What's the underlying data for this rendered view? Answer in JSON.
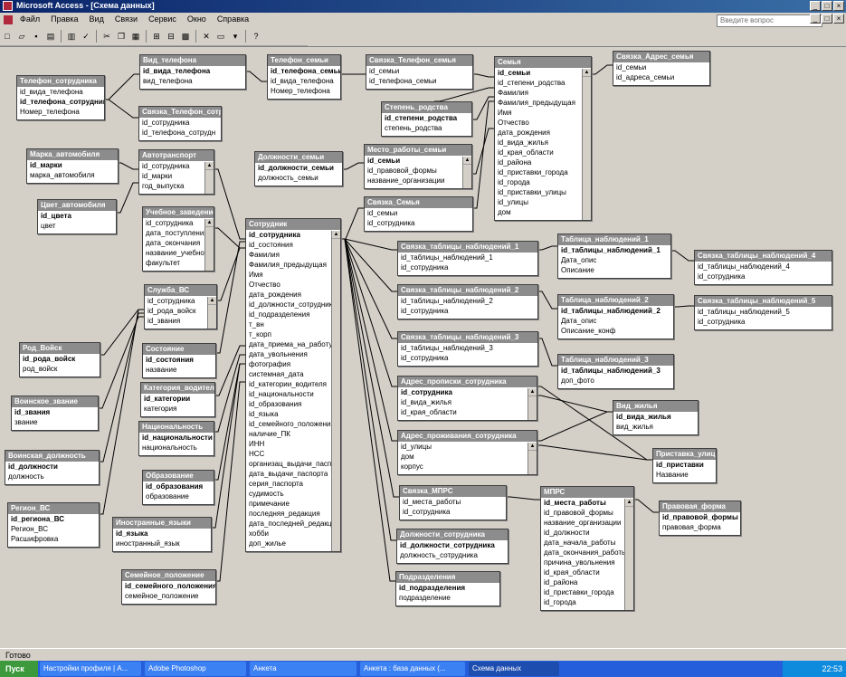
{
  "window": {
    "app_title": "Microsoft Access - [Схема данных]",
    "minimize": "_",
    "maximize": "□",
    "close": "×"
  },
  "menu": {
    "items": [
      "Файл",
      "Правка",
      "Вид",
      "Связи",
      "Сервис",
      "Окно",
      "Справка"
    ],
    "ask_placeholder": "Введите вопрос"
  },
  "toolbar": {
    "icons": [
      "new-icon",
      "open-icon",
      "save-icon",
      "print-preview-icon",
      "print-icon",
      "spell-icon",
      "cut-icon",
      "copy-icon",
      "paste-icon",
      "show-table-icon",
      "show-direct-icon",
      "show-all-icon",
      "delete-icon",
      "hide-table-icon",
      "new-object-icon",
      "help-icon"
    ]
  },
  "tables": [
    {
      "id": "telefon_sotr",
      "title": "Телефон_сотрудника",
      "fields": [
        "id_вида_телефона",
        "id_телефона_сотрудник",
        "Номер_телефона"
      ],
      "pk": [
        1
      ]
    },
    {
      "id": "vid_telefona",
      "title": "Вид_телефона",
      "fields": [
        "id_вида_телефона",
        "вид_телефона"
      ],
      "pk": [
        0
      ]
    },
    {
      "id": "telefon_semi",
      "title": "Телефон_семьи",
      "fields": [
        "id_телефона_семьи",
        "id_вида_телефона",
        "Номер_телефона"
      ],
      "pk": [
        0
      ]
    },
    {
      "id": "svyaz_tel_semya",
      "title": "Связка_Телефон_семья",
      "fields": [
        "id_семьи",
        "id_телефона_семьи"
      ],
      "pk": []
    },
    {
      "id": "semya",
      "title": "Семья",
      "fields": [
        "id_семьи",
        "id_степени_родства",
        "Фамилия",
        "Фамилия_предыдущая",
        "Имя",
        "Отчество",
        "дата_рождения",
        "id_вида_жилья",
        "id_края_области",
        "id_района",
        "id_приставки_города",
        "id_города",
        "id_приставки_улицы",
        "id_улицы",
        "дом"
      ],
      "pk": [
        0
      ],
      "scroll": true
    },
    {
      "id": "svyaz_adres_semya",
      "title": "Связка_Адрес_семья",
      "fields": [
        "id_семьи",
        "id_адреса_семьи"
      ],
      "pk": []
    },
    {
      "id": "svyaz_tel_sotr",
      "title": "Связка_Телефон_сотру",
      "fields": [
        "id_сотрудника",
        "id_телефона_сотрудн"
      ],
      "pk": []
    },
    {
      "id": "stepen_rodstva",
      "title": "Степень_родства",
      "fields": [
        "id_степени_родства",
        "степень_родства"
      ],
      "pk": [
        0
      ]
    },
    {
      "id": "marka_avto",
      "title": "Марка_автомобиля",
      "fields": [
        "id_марки",
        "марка_автомобиля"
      ],
      "pk": [
        0
      ]
    },
    {
      "id": "avtotransport",
      "title": "Автотранспорт",
      "fields": [
        "id_сотрудника",
        "id_марки",
        "год_выпуска"
      ],
      "pk": [],
      "scroll": true
    },
    {
      "id": "dolzhnosti_semi",
      "title": "Должности_семьи",
      "fields": [
        "id_должности_семьи",
        "должность_семьи"
      ],
      "pk": [
        0
      ]
    },
    {
      "id": "mesto_raboty_semi",
      "title": "Место_работы_семьи",
      "fields": [
        "id_семьи",
        "id_правовой_формы",
        "название_организации"
      ],
      "pk": [
        0
      ],
      "scroll": true
    },
    {
      "id": "tsvet_avto",
      "title": "Цвет_автомобиля",
      "fields": [
        "id_цвета",
        "цвет"
      ],
      "pk": [
        0
      ]
    },
    {
      "id": "svyaz_semya",
      "title": "Связка_Семья",
      "fields": [
        "id_семьи",
        "id_сотрудника"
      ],
      "pk": []
    },
    {
      "id": "uchebnye_zaved",
      "title": "Учебное_заведение",
      "fields": [
        "id_сотрудника",
        "дата_поступления",
        "дата_окончания",
        "название_учебного",
        "факультет"
      ],
      "pk": [],
      "scroll": true
    },
    {
      "id": "sotrudnik",
      "title": "Сотрудник",
      "fields": [
        "id_сотрудника",
        "id_состояния",
        "Фамилия",
        "Фамилия_предыдущая",
        "Имя",
        "Отчество",
        "дата_рождения",
        "id_должности_сотрудника",
        "id_подразделения",
        "т_вн",
        "т_корп",
        "дата_приема_на_работу",
        "дата_увольнения",
        "фотография",
        "системная_дата",
        "id_категории_водителя",
        "id_национальности",
        "id_образования",
        "id_языка",
        "id_семейного_положения",
        "наличие_ПК",
        "ИНН",
        "НСС",
        "организац_выдачи_паспорта",
        "дата_выдачи_паспорта",
        "серия_паспорта",
        "судимость",
        "примечание",
        "последняя_редакция",
        "дата_последней_редакции",
        "хобби",
        "доп_жилье"
      ],
      "pk": [
        0
      ],
      "scroll": true
    },
    {
      "id": "svyaz_tabl_1",
      "title": "Связка_таблицы_наблюдений_1",
      "fields": [
        "id_таблицы_наблюдений_1",
        "id_сотрудника"
      ],
      "pk": []
    },
    {
      "id": "tabl_nabl_1",
      "title": "Таблица_наблюдений_1",
      "fields": [
        "id_таблицы_наблюдений_1",
        "Дата_опис",
        "Описание"
      ],
      "pk": [
        0
      ]
    },
    {
      "id": "svyaz_tabl_4",
      "title": "Связка_таблицы_наблюдений_4",
      "fields": [
        "id_таблицы_наблюдений_4",
        "id_сотрудника"
      ],
      "pk": []
    },
    {
      "id": "sluzhba_vs",
      "title": "Служба_ВС",
      "fields": [
        "id_сотрудника",
        "id_рода_войск",
        "id_звания"
      ],
      "pk": [],
      "scroll": true
    },
    {
      "id": "svyaz_tabl_2",
      "title": "Связка_таблицы_наблюдений_2",
      "fields": [
        "id_таблицы_наблюдений_2",
        "id_сотрудника"
      ],
      "pk": []
    },
    {
      "id": "tabl_nabl_2",
      "title": "Таблица_наблюдений_2",
      "fields": [
        "id_таблицы_наблюдений_2",
        "Дата_опис",
        "Описание_конф"
      ],
      "pk": [
        0
      ]
    },
    {
      "id": "svyaz_tabl_5",
      "title": "Связка_таблицы_наблюдений_5",
      "fields": [
        "id_таблицы_наблюдений_5",
        "id_сотрудника"
      ],
      "pk": []
    },
    {
      "id": "rod_voisk",
      "title": "Род_Войск",
      "fields": [
        "id_рода_войск",
        "род_войск"
      ],
      "pk": [
        0
      ]
    },
    {
      "id": "sostoyanie",
      "title": "Состояние",
      "fields": [
        "id_состояния",
        "название"
      ],
      "pk": [
        0
      ]
    },
    {
      "id": "svyaz_tabl_3",
      "title": "Связка_таблицы_наблюдений_3",
      "fields": [
        "id_таблицы_наблюдений_3",
        "id_сотрудника"
      ],
      "pk": []
    },
    {
      "id": "tabl_nabl_3",
      "title": "Таблица_наблюдений_3",
      "fields": [
        "id_таблицы_наблюдений_3",
        "доп_фото"
      ],
      "pk": [
        0
      ]
    },
    {
      "id": "kategoriya_vod",
      "title": "Категория_водителя",
      "fields": [
        "id_категории",
        "категория"
      ],
      "pk": [
        0
      ]
    },
    {
      "id": "adres_propiski",
      "title": "Адрес_прописки_сотрудника",
      "fields": [
        "id_сотрудника",
        "id_вида_жилья",
        "id_края_области"
      ],
      "pk": [
        0
      ],
      "scroll": true
    },
    {
      "id": "voinskoe_zvanie",
      "title": "Воинское_звание",
      "fields": [
        "id_звания",
        "звание"
      ],
      "pk": [
        0
      ]
    },
    {
      "id": "vid_zhilya",
      "title": "Вид_жилья",
      "fields": [
        "id_вида_жилья",
        "вид_жилья"
      ],
      "pk": [
        0
      ]
    },
    {
      "id": "natsionalnost",
      "title": "Национальность",
      "fields": [
        "id_национальности",
        "национальность"
      ],
      "pk": [
        0
      ]
    },
    {
      "id": "adres_prozhivaniya",
      "title": "Адрес_проживания_сотрудника",
      "fields": [
        "id_улицы",
        "дом",
        "корпус"
      ],
      "pk": [],
      "scroll": true
    },
    {
      "id": "voinskaya_dolzhnost",
      "title": "Воинская_должность",
      "fields": [
        "id_должности",
        "должность"
      ],
      "pk": [
        0
      ]
    },
    {
      "id": "pristavka_ulitsy",
      "title": "Приставка_улицы",
      "fields": [
        "id_приставки",
        "Название"
      ],
      "pk": [
        0
      ]
    },
    {
      "id": "obrazovanie",
      "title": "Образование",
      "fields": [
        "id_образования",
        "образование"
      ],
      "pk": [
        0
      ]
    },
    {
      "id": "svyaz_mprs",
      "title": "Связка_МПРС",
      "fields": [
        "id_места_работы",
        "id_сотрудника"
      ],
      "pk": []
    },
    {
      "id": "mprs",
      "title": "МПРС",
      "fields": [
        "id_места_работы",
        "id_правовой_формы",
        "название_организации",
        "id_должности",
        "дата_начала_работы",
        "дата_окончания_работы",
        "причина_увольнения",
        "id_края_области",
        "id_района",
        "id_приставки_города",
        "id_города"
      ],
      "pk": [
        0
      ],
      "scroll": true
    },
    {
      "id": "pravovaya_forma",
      "title": "Правовая_форма",
      "fields": [
        "id_правовой_формы",
        "правовая_форма"
      ],
      "pk": [
        0
      ]
    },
    {
      "id": "region_vs",
      "title": "Регион_ВС",
      "fields": [
        "id_региона_ВС",
        "Регион_ВС",
        "Расшифровка"
      ],
      "pk": [
        0
      ]
    },
    {
      "id": "inostrannye_yazyki",
      "title": "Иностранные_языки",
      "fields": [
        "id_языка",
        "иностранный_язык"
      ],
      "pk": [
        0
      ]
    },
    {
      "id": "dolzhnosti_sotr",
      "title": "Должности_сотрудника",
      "fields": [
        "id_должности_сотрудника",
        "должность_сотрудника"
      ],
      "pk": [
        0
      ]
    },
    {
      "id": "podrazdeleniya",
      "title": "Подразделения",
      "fields": [
        "id_подразделения",
        "подразделение"
      ],
      "pk": [
        0
      ]
    },
    {
      "id": "semeinoe_polozhenie",
      "title": "Семейное_положение",
      "fields": [
        "id_семейного_положения",
        "семейное_положение"
      ],
      "pk": [
        0
      ]
    }
  ],
  "status": {
    "text": "Готово"
  },
  "taskbar": {
    "start": "Пуск",
    "items": [
      "Настройки профиля | А...",
      "Adobe Photoshop",
      "Анкета",
      "Анкета : база данных (...",
      "Схема данных"
    ],
    "clock": "22:53"
  }
}
